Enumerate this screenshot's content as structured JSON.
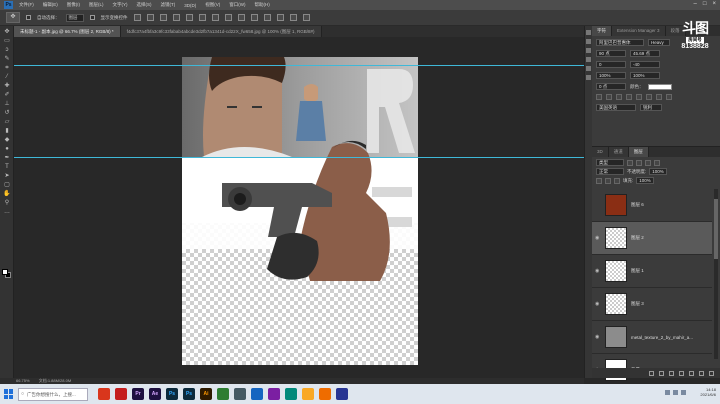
{
  "menubar": {
    "logo": "Ps",
    "items": [
      "文件(F)",
      "编辑(E)",
      "图像(I)",
      "图层(L)",
      "文字(Y)",
      "选择(S)",
      "滤镜(T)",
      "3D(D)",
      "视图(V)",
      "窗口(W)",
      "帮助(H)"
    ],
    "controls": [
      "–",
      "□",
      "×"
    ]
  },
  "options": {
    "auto_select_label": "自动选择：",
    "auto_select_value": "图层",
    "transform_label": "显示变换控件"
  },
  "tabs": [
    {
      "label": "未标题-1 - 副本.jpg @ 66.7% (图层 2, RGB/8) *",
      "active": true
    },
    {
      "label": "f4dfc37a4fbfa3c9fc33fabab4abcde3d2fb7a1341d-cd22X_fw658.jpg @ 100% (图层 1, RGB/8#)",
      "active": false
    }
  ],
  "status": {
    "zoom": "66.75%",
    "doc": "文档:1.88M/28.0M"
  },
  "right_panel": {
    "tabs": [
      "字符",
      "Extension Manager 3",
      "段落"
    ],
    "font_family": "阿里巴巴普惠体",
    "font_style": "Heavy",
    "font_size": "90 点",
    "leading": "45.69 点",
    "tracking": "0",
    "kerning": "-40",
    "scale_v": "100%",
    "scale_h": "100%",
    "baseline": "0 点",
    "color_label": "颜色：",
    "language": "美国英语",
    "antialias": "锐利",
    "watermark_logo": "斗图",
    "watermark_sub": "房间号",
    "watermark_num": "8138828"
  },
  "layers_panel": {
    "tabs": [
      "3D",
      "通道",
      "图层"
    ],
    "kind_label": "类型",
    "blend_mode": "正常",
    "opacity_label": "不透明度:",
    "opacity": "100%",
    "fill_label": "填充:",
    "fill": "100%",
    "layers": [
      {
        "name": "图层 6",
        "selected": false
      },
      {
        "name": "图层 2",
        "selected": true
      },
      {
        "name": "图层 1",
        "selected": false
      },
      {
        "name": "图层 3",
        "selected": false
      },
      {
        "name": "metal_texture_2_by_mahir_a...",
        "selected": false
      },
      {
        "name": "背景",
        "selected": false
      }
    ]
  },
  "taskbar": {
    "search_placeholder": "广告你想搜什么，上搜...",
    "time": "14:18",
    "date": "2021/6/6"
  }
}
